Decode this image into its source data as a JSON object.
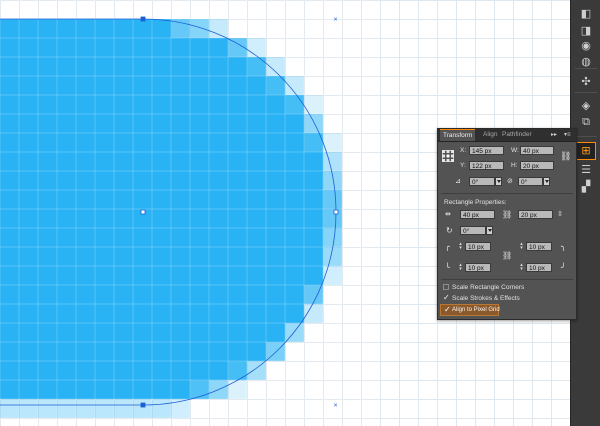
{
  "panel": {
    "tabs": {
      "transform": "Transform",
      "align": "Align",
      "pathfinder": "Pathfinder",
      "collapse_icon": "double-arrow-right-icon",
      "menu_icon": "panel-menu-icon"
    },
    "x_label": "X:",
    "x_value": "145 px",
    "w_label": "W:",
    "w_value": "40 px",
    "y_label": "Y:",
    "y_value": "122 px",
    "h_label": "H:",
    "h_value": "20 px",
    "rotate_value": "0°",
    "shear_value": "0°",
    "rect_props_label": "Rectangle Properties:",
    "rect_w_value": "40 px",
    "rect_h_value": "20 px",
    "rect_rotate_value": "0°",
    "corner_tl": "10 px",
    "corner_tr": "10 px",
    "corner_bl": "10 px",
    "corner_br": "10 px",
    "scale_corners_label": "Scale Rectangle Corners",
    "scale_corners_checked": false,
    "scale_strokes_label": "Scale Strokes & Effects",
    "scale_strokes_checked": true,
    "pixel_grid_label": "Align to Pixel Grid",
    "pixel_grid_checked": true
  },
  "colors": {
    "shape_fill": "#29b3f4",
    "selection": "#1a5fd6",
    "accent": "#ff8a00"
  },
  "toolstrip": {
    "tools": [
      "color-icon",
      "color-guide-icon",
      "appearance-icon",
      "graphic-styles-icon",
      "symbols-icon",
      "layers-icon",
      "artboards-icon",
      "transform-icon",
      "align-icon",
      "pathfinder-icon"
    ],
    "active": "transform-icon"
  }
}
